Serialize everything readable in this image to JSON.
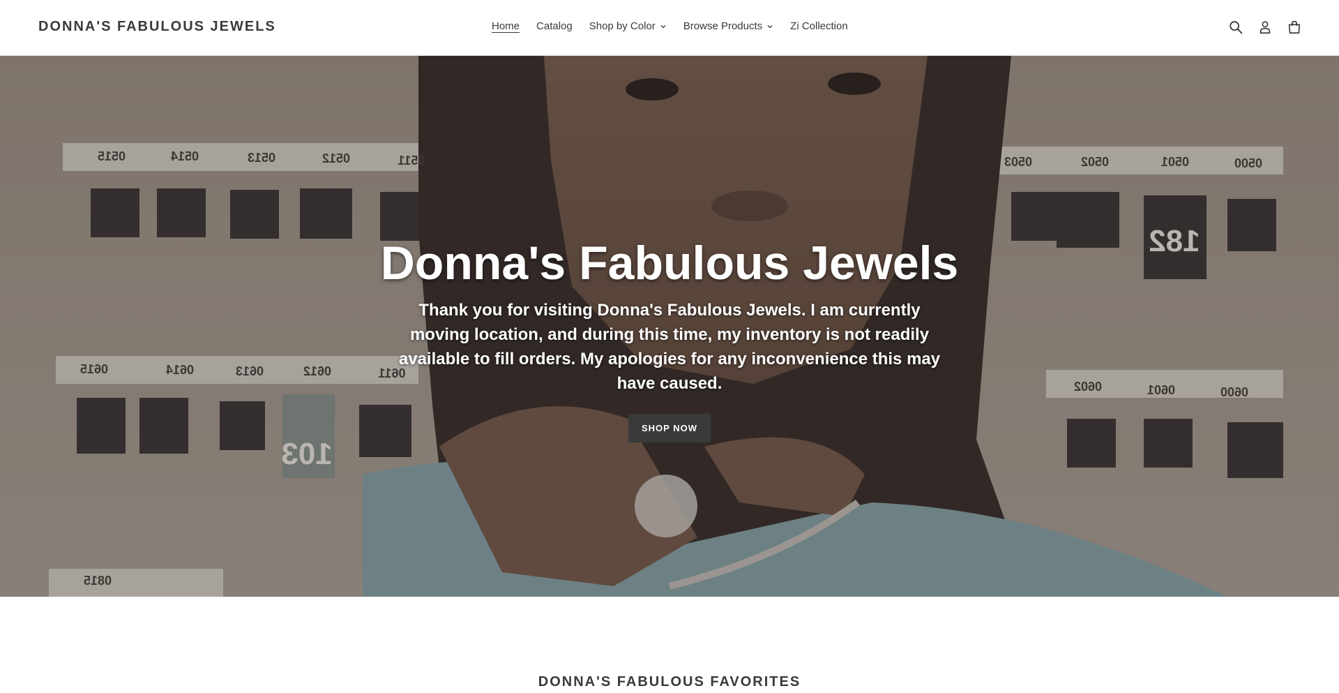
{
  "header": {
    "brand": "DONNA'S FABULOUS JEWELS",
    "nav": [
      {
        "label": "Home",
        "active": true,
        "dropdown": false
      },
      {
        "label": "Catalog",
        "active": false,
        "dropdown": false
      },
      {
        "label": "Shop by Color",
        "active": false,
        "dropdown": true
      },
      {
        "label": "Browse Products",
        "active": false,
        "dropdown": true
      },
      {
        "label": "Zi Collection",
        "active": false,
        "dropdown": false
      }
    ],
    "icons": [
      "search-icon",
      "account-icon",
      "cart-icon"
    ]
  },
  "hero": {
    "title": "Donna's Fabulous Jewels",
    "text": "Thank you for visiting Donna's Fabulous Jewels. I am currently moving location, and during this time, my inventory is not readily available to fill orders. My apologies for any inconvenience this may have caused.",
    "button": "SHOP NOW",
    "image_labels": [
      "0515",
      "0514",
      "0513",
      "0512",
      "0511",
      "0503",
      "0502",
      "0501",
      "0500",
      "182",
      "0615",
      "0614",
      "0613",
      "0612",
      "0611",
      "103",
      "0602",
      "0601",
      "0600",
      "0815"
    ]
  },
  "favorites": {
    "title": "DONNA'S FABULOUS FAVORITES"
  },
  "colors": {
    "accent": "#3a3a3a",
    "background": "#ffffff",
    "hero_text": "#ffffff"
  }
}
